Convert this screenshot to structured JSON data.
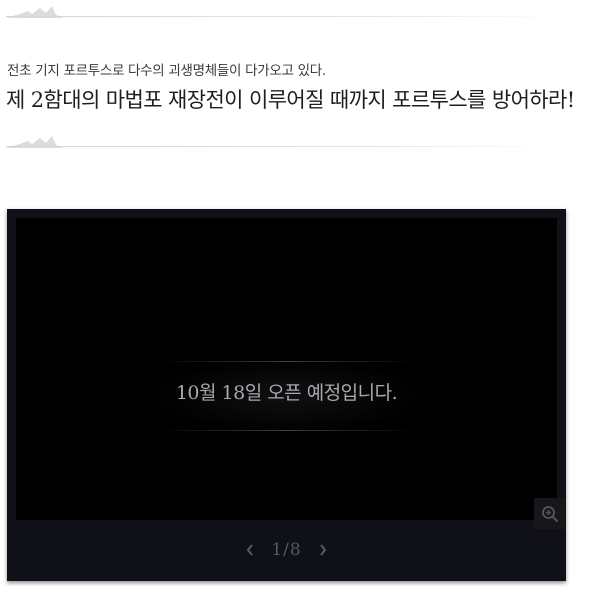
{
  "notice": {
    "subtitle": "전초 기지 포르투스로 다수의 괴생명체들이 다가오고 있다.",
    "headline": "제 2함대의 마법포 재장전이 이루어질 때까지 포르투스를 방어하라!"
  },
  "viewer": {
    "slide_text": "10월 18일 오픈 예정입니다.",
    "pager": {
      "current": 1,
      "total": 8,
      "label": "1/8"
    },
    "icons": {
      "zoom": "zoom-in-icon",
      "prev": "chevron-left-icon",
      "next": "chevron-right-icon"
    }
  },
  "colors": {
    "viewer_bg": "#0f1018",
    "slide_bg": "#000000",
    "slide_text": "#a9a9ae",
    "pager_text": "#585a63"
  }
}
